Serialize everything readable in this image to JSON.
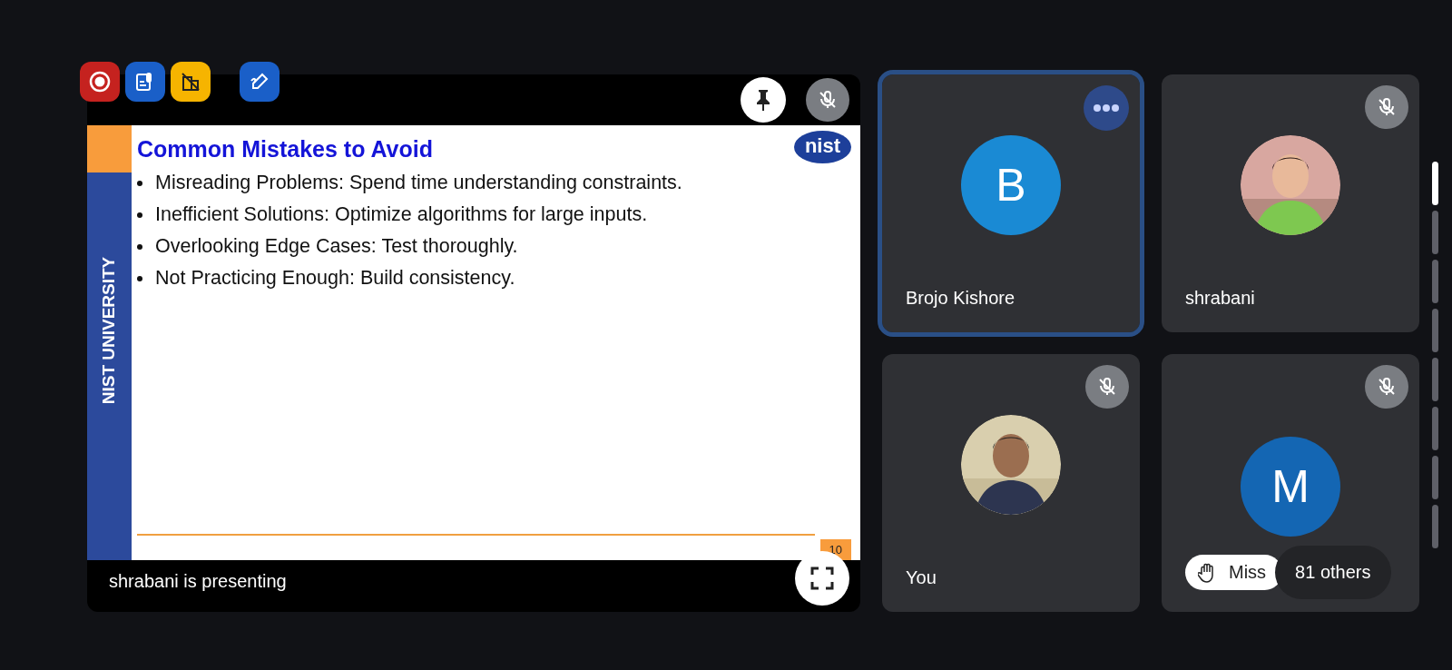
{
  "toolbar": [
    {
      "kind": "record"
    },
    {
      "kind": "transcript"
    },
    {
      "kind": "no-grid"
    },
    {
      "kind": "annotate"
    }
  ],
  "presentation": {
    "muted": true,
    "caption": "shrabani is presenting",
    "slide": {
      "title": "Common Mistakes to Avoid",
      "logo": "nist",
      "side_label": "NIST UNIVERSITY",
      "bullets": [
        "Misreading Problems: Spend time understanding constraints.",
        "Inefficient Solutions: Optimize algorithms for large inputs.",
        "Overlooking Edge Cases: Test thoroughly.",
        "Not Practicing Enough: Build consistency."
      ],
      "page_number": "10"
    }
  },
  "participants": [
    {
      "name": "Brojo Kishore",
      "kind": "letter",
      "initial": "B",
      "color": "#1a8ad4",
      "selected": true,
      "muted": false
    },
    {
      "name": "shrabani",
      "selected": false,
      "muted": true
    },
    {
      "name": "You",
      "selected": false,
      "muted": true
    },
    {
      "kind": "letter",
      "initial": "M",
      "color": "#1466b3",
      "selected": false,
      "muted": true,
      "hand_raised": "Miss",
      "others": "81 others"
    }
  ],
  "pages": [
    {
      "selected": true
    },
    {
      "selected": false
    },
    {
      "selected": false
    },
    {
      "selected": false
    },
    {
      "selected": false
    },
    {
      "selected": false
    },
    {
      "selected": false
    },
    {
      "selected": false
    }
  ]
}
